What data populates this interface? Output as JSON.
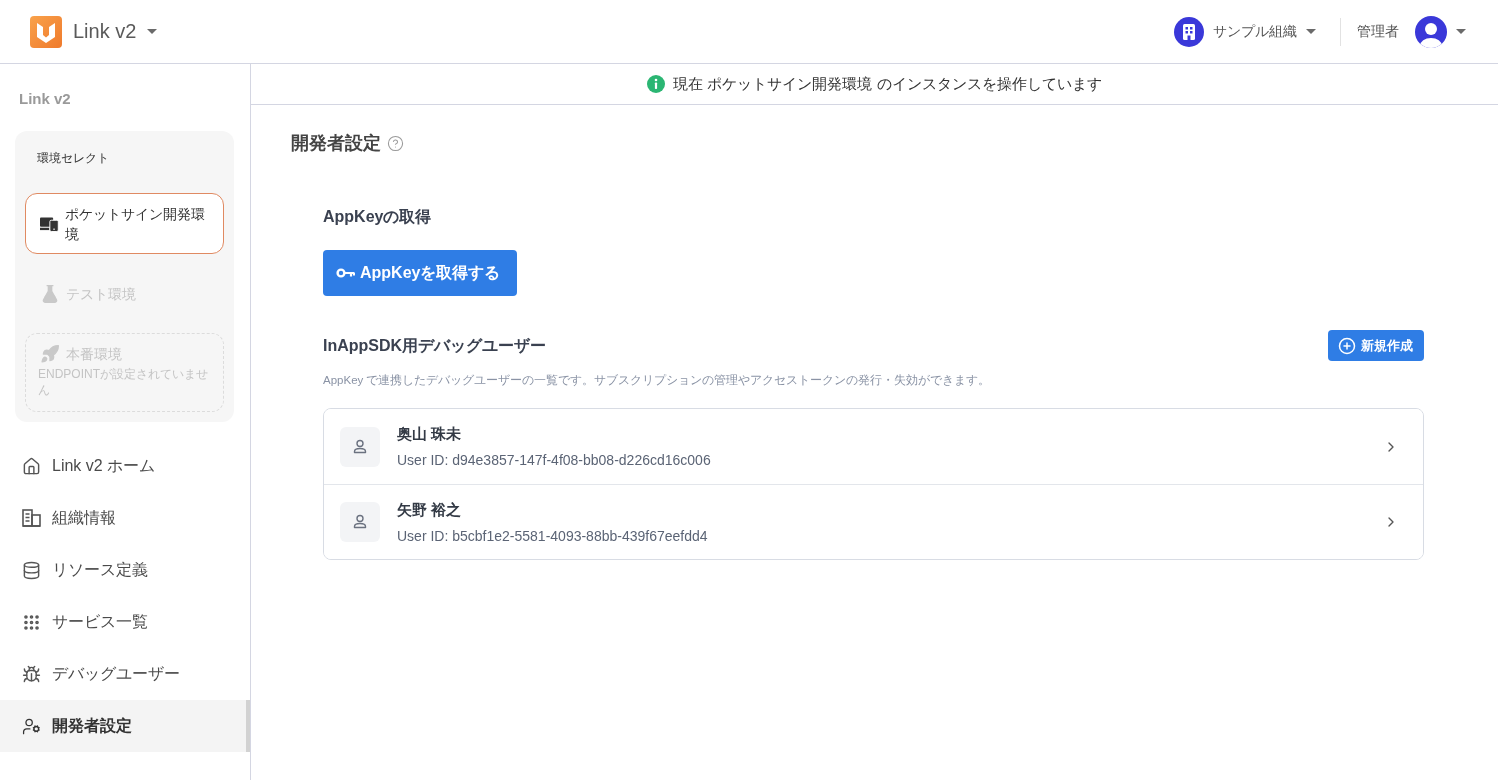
{
  "header": {
    "app_name": "Link v2",
    "organization": "サンプル組織",
    "role": "管理者"
  },
  "sidebar": {
    "title": "Link v2",
    "environment_select": {
      "label": "環境セレクト",
      "environments": [
        {
          "name": "ポケットサイン開発環境",
          "selected": true,
          "disabled": false
        },
        {
          "name": "テスト環境",
          "selected": false,
          "disabled": true
        },
        {
          "name": "本番環境",
          "note": "ENDPOINTが設定されていません",
          "selected": false,
          "disabled": true
        }
      ]
    },
    "nav_items": [
      {
        "label": "Link v2 ホーム",
        "selected": false
      },
      {
        "label": "組織情報",
        "selected": false
      },
      {
        "label": "リソース定義",
        "selected": false
      },
      {
        "label": "サービス一覧",
        "selected": false
      },
      {
        "label": "デバッグユーザー",
        "selected": false
      },
      {
        "label": "開発者設定",
        "selected": true
      }
    ]
  },
  "banner": {
    "text": "現在 ポケットサイン開発環境 のインスタンスを操作しています"
  },
  "page": {
    "title": "開発者設定",
    "appkey_section": {
      "heading": "AppKeyの取得",
      "button": "AppKeyを取得する"
    },
    "debug_users_section": {
      "heading": "InAppSDK用デバッグユーザー",
      "create_button": "新規作成",
      "description": "AppKey で連携したデバッグユーザーの一覧です。サブスクリプションの管理やアクセストークンの発行・失効ができます。",
      "users": [
        {
          "name": "奥山 珠未",
          "user_id": "User ID: d94e3857-147f-4f08-bb08-d226cd16c006"
        },
        {
          "name": "矢野 裕之",
          "user_id": "User ID: b5cbf1e2-5581-4093-88bb-439f67eefdd4"
        }
      ]
    }
  }
}
